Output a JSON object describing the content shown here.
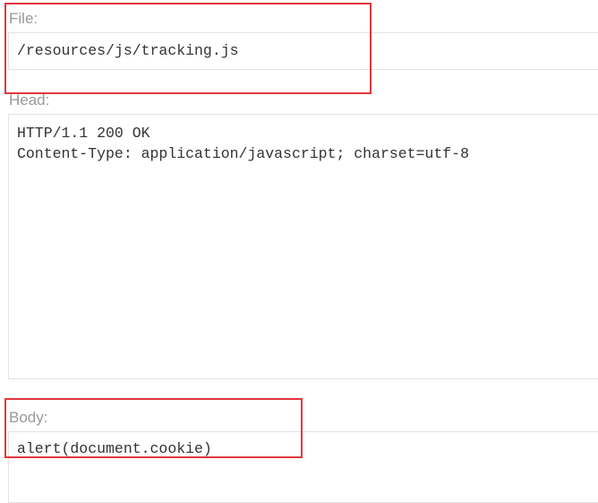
{
  "file": {
    "label": "File:",
    "value": "/resources/js/tracking.js"
  },
  "head": {
    "label": "Head:",
    "value": "HTTP/1.1 200 OK\nContent-Type: application/javascript; charset=utf-8"
  },
  "body": {
    "label": "Body:",
    "value": "alert(document.cookie)"
  },
  "colors": {
    "highlight": "#e0383d",
    "label": "#999999",
    "text": "#333333",
    "border": "#e3e3e3"
  }
}
